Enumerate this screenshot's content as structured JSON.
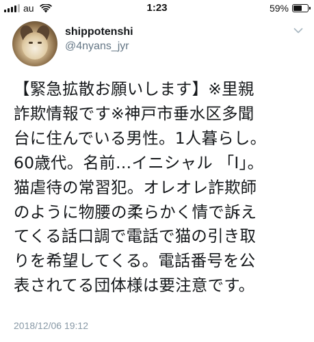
{
  "status_bar": {
    "carrier": "au",
    "time": "1:23",
    "battery_percent": "59%",
    "battery_level": 0.59
  },
  "profile": {
    "display_name": "shippotenshi",
    "handle": "@4nyans_jyr"
  },
  "tweet": {
    "lines": [
      "【緊急拡散お願いします】※里親",
      "詐欺情報です※神戸市垂水区多聞",
      "台に住んでいる男性。1人暮らし。",
      "60歳代。名前…イニシャル 「I」。",
      "猫虐待の常習犯。オレオレ詐欺師",
      "のように物腰の柔らかく情で訴え",
      "てくる話口調で電話で猫の引き取",
      "りを希望してくる。電話番号を公",
      "表されてる団体様は要注意です。"
    ],
    "timestamp": "2018/12/06 19:12"
  },
  "icons": {
    "signal": "signal-bars-icon",
    "wifi": "wifi-icon",
    "battery": "battery-icon",
    "more": "chevron-down-icon"
  }
}
